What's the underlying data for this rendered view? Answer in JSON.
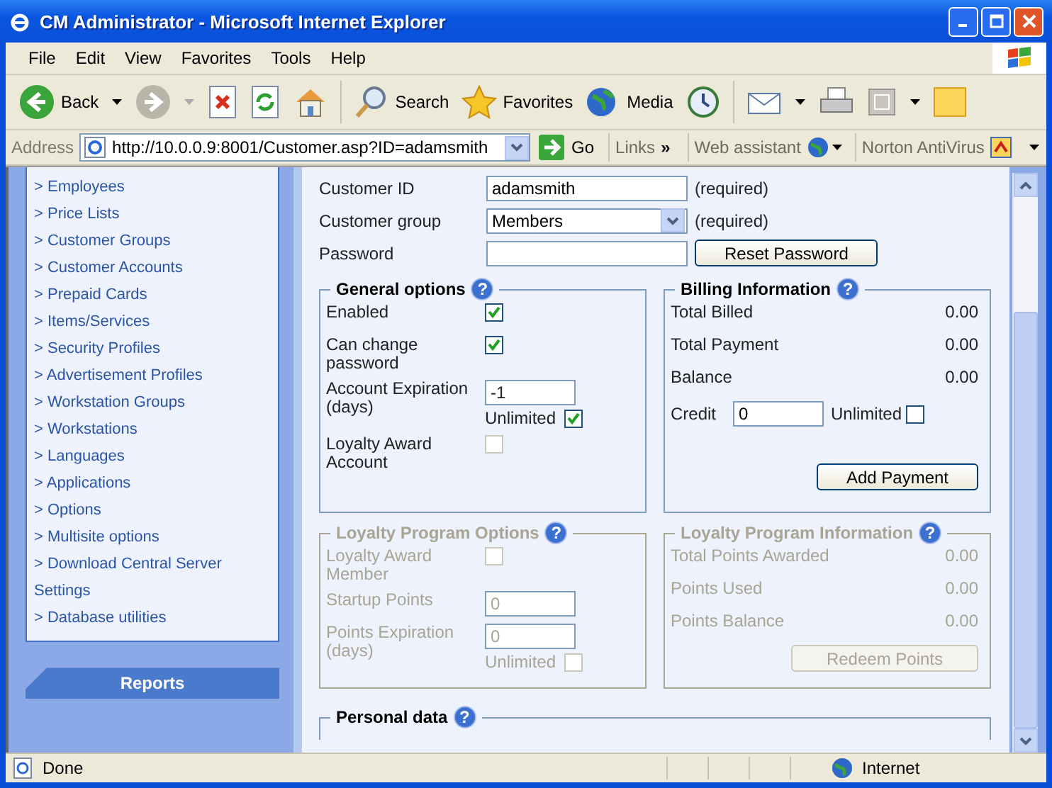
{
  "window": {
    "title": "CM Administrator - Microsoft Internet Explorer"
  },
  "menu": [
    "File",
    "Edit",
    "View",
    "Favorites",
    "Tools",
    "Help"
  ],
  "toolbar": [
    {
      "kind": "back",
      "label": "Back"
    },
    {
      "kind": "forward"
    },
    {
      "kind": "stop"
    },
    {
      "kind": "refresh"
    },
    {
      "kind": "home"
    },
    {
      "kind": "search",
      "label": "Search"
    },
    {
      "kind": "favorites",
      "label": "Favorites"
    },
    {
      "kind": "media",
      "label": "Media"
    },
    {
      "kind": "history"
    },
    {
      "kind": "mail"
    },
    {
      "kind": "print"
    },
    {
      "kind": "edit"
    },
    {
      "kind": "note"
    }
  ],
  "address": {
    "label": "Address",
    "url": "http://10.0.0.9:8001/Customer.asp?ID=adamsmith",
    "go": "Go",
    "links": "Links",
    "more": "»",
    "assistant": "Web assistant",
    "antivirus": "Norton AntiVirus"
  },
  "sidebar": {
    "items": [
      "> Employees",
      "> Price Lists",
      "> Customer Groups",
      "> Customer Accounts",
      "> Prepaid Cards",
      "> Items/Services",
      "> Security Profiles",
      "> Advertisement Profiles",
      "> Workstation Groups",
      "> Workstations",
      "> Languages",
      "> Applications",
      "> Options",
      "> Multisite options",
      "> Download Central Server Settings",
      "> Database utilities"
    ],
    "reports": "Reports"
  },
  "fields": [
    {
      "kind": "text",
      "label": "Customer ID",
      "value": "adamsmith",
      "note": "(required)"
    },
    {
      "kind": "select",
      "label": "Customer group",
      "value": "Members",
      "note": "(required)"
    },
    {
      "kind": "password",
      "label": "Password",
      "button": "Reset Password"
    }
  ],
  "panels": [
    {
      "title": "General options",
      "help": "?",
      "disabled": false,
      "rows": [
        {
          "kind": "check",
          "label": "Enabled",
          "checked": true,
          "disabled": false
        },
        {
          "kind": "check",
          "label": "Can change password",
          "checked": true,
          "disabled": false
        },
        {
          "kind": "input",
          "label": "Account Expiration (days)",
          "value": "-1",
          "unlimited": "Unlimited",
          "checked": true
        },
        {
          "kind": "check",
          "label": "Loyalty Award Account",
          "checked": false,
          "disabled": true
        }
      ]
    },
    {
      "title": "Billing Information",
      "help": "?",
      "disabled": false,
      "rows": [
        {
          "kind": "amount",
          "label": "Total Billed",
          "value": "0.00"
        },
        {
          "kind": "amount",
          "label": "Total Payment",
          "value": "0.00"
        },
        {
          "kind": "amount",
          "label": "Balance",
          "value": "0.00"
        },
        {
          "kind": "credit",
          "label": "Credit",
          "value": "0",
          "unlimited": "Unlimited",
          "checked": false
        }
      ],
      "button": "Add Payment"
    },
    {
      "title": "Loyalty Program Options",
      "help": "?",
      "disabled": true,
      "rows": [
        {
          "kind": "check",
          "label": "Loyalty Award Member",
          "checked": false,
          "disabled": true
        },
        {
          "kind": "input",
          "label": "Startup Points",
          "value": "0"
        },
        {
          "kind": "input",
          "label": "Points Expiration (days)",
          "value": "0",
          "unlimited": "Unlimited",
          "checked": false
        }
      ]
    },
    {
      "title": "Loyalty Program Information",
      "help": "?",
      "disabled": true,
      "rows": [
        {
          "kind": "amount",
          "label": "Total Points Awarded",
          "value": "0.00"
        },
        {
          "kind": "amount",
          "label": "Points Used",
          "value": "0.00"
        },
        {
          "kind": "amount",
          "label": "Points Balance",
          "value": "0.00"
        }
      ],
      "button": "Redeem Points"
    }
  ],
  "personal": {
    "title": "Personal data",
    "help": "?"
  },
  "status": {
    "text": "Done",
    "zone": "Internet"
  }
}
